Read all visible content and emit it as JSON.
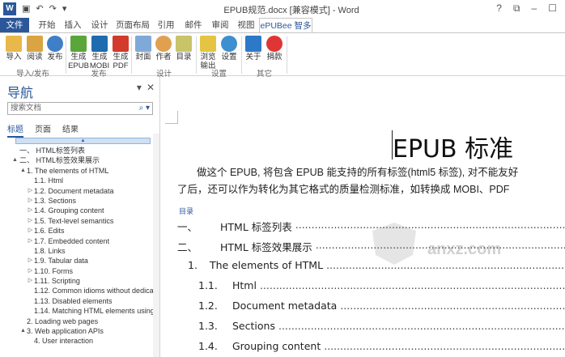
{
  "window": {
    "title": "EPUB规范.docx [兼容模式] - Word",
    "controls": [
      "?",
      "⧉",
      "–",
      "☐"
    ]
  },
  "tabs": {
    "file": "文件",
    "items": [
      "开始",
      "插入",
      "设计",
      "页面布局",
      "引用",
      "邮件",
      "审阅",
      "视图"
    ],
    "active": "ePUBee 智多星"
  },
  "ribbon": {
    "buttons": [
      {
        "label": "导入",
        "icon": "import-icon"
      },
      {
        "label": "阅读",
        "icon": "book-icon"
      },
      {
        "label": "发布",
        "icon": "globe-icon"
      },
      {
        "label": "生成 EPUB",
        "icon": "epub-icon"
      },
      {
        "label": "生成 MOBI",
        "icon": "mobi-icon"
      },
      {
        "label": "生成 PDF",
        "icon": "pdf-icon"
      },
      {
        "label": "封面",
        "icon": "cover-icon"
      },
      {
        "label": "作者",
        "icon": "author-icon"
      },
      {
        "label": "目录",
        "icon": "toc-icon"
      },
      {
        "label": "浏览 输出",
        "icon": "folder-icon"
      },
      {
        "label": "设置",
        "icon": "gear-icon"
      },
      {
        "label": "关于",
        "icon": "about-icon"
      },
      {
        "label": "捐款",
        "icon": "heart-icon"
      }
    ],
    "groups": [
      "导入/发布",
      "发布",
      "设计",
      "设置",
      "其它"
    ]
  },
  "nav": {
    "title": "导航",
    "search_placeholder": "搜索文档",
    "tabs": [
      "标题",
      "页面",
      "结果"
    ],
    "headings": [
      {
        "text": "一、 HTML标签列表",
        "level": 1,
        "expander": ""
      },
      {
        "text": "二、 HTML标签效果展示",
        "level": 1,
        "expander": "▲"
      },
      {
        "text": "1. The elements of HTML",
        "level": 2,
        "expander": "▲"
      },
      {
        "text": "1.1. Html",
        "level": 3,
        "expander": ""
      },
      {
        "text": "1.2. Document metadata",
        "level": 3,
        "expander": "▷"
      },
      {
        "text": "1.3. Sections",
        "level": 3,
        "expander": "▷"
      },
      {
        "text": "1.4. Grouping content",
        "level": 3,
        "expander": "▷"
      },
      {
        "text": "1.5. Text-level semantics",
        "level": 3,
        "expander": "▷"
      },
      {
        "text": "1.6. Edits",
        "level": 3,
        "expander": "▷"
      },
      {
        "text": "1.7. Embedded content",
        "level": 3,
        "expander": "▷"
      },
      {
        "text": "1.8. Links",
        "level": 3,
        "expander": ""
      },
      {
        "text": "1.9. Tabular data",
        "level": 3,
        "expander": "▷"
      },
      {
        "text": "1.10. Forms",
        "level": 3,
        "expander": "▷"
      },
      {
        "text": "1.11. Scripting",
        "level": 3,
        "expander": "▷"
      },
      {
        "text": "1.12. Common idioms without dedicat...",
        "level": 3,
        "expander": ""
      },
      {
        "text": "1.13. Disabled elements",
        "level": 3,
        "expander": ""
      },
      {
        "text": "1.14. Matching HTML elements using...",
        "level": 3,
        "expander": ""
      },
      {
        "text": "2. Loading web pages",
        "level": 2,
        "expander": ""
      },
      {
        "text": "3. Web application APIs",
        "level": 2,
        "expander": "▲"
      },
      {
        "text": "4. User interaction",
        "level": 3,
        "expander": ""
      }
    ]
  },
  "doc": {
    "title": "EPUB 标准",
    "para_line1": "做这个 EPUB, 将包含 EPUB 能支持的所有标签(html5 标签), 对不能友好",
    "para_line2": "了后，还可以作为转化为其它格式的质量检测标准，如转换成 MOBI、PDF",
    "toc_label": "目录",
    "toc": [
      {
        "num": "一、",
        "label": "HTML 标签列表"
      },
      {
        "num": "二、",
        "label": "HTML 标签效果展示"
      },
      {
        "num": "1.",
        "label": "The elements of HTML"
      },
      {
        "num": "1.1.",
        "label": "Html"
      },
      {
        "num": "1.2.",
        "label": "Document metadata"
      },
      {
        "num": "1.3.",
        "label": "Sections"
      },
      {
        "num": "1.4.",
        "label": "Grouping content"
      }
    ],
    "watermark": "anxz.com"
  }
}
